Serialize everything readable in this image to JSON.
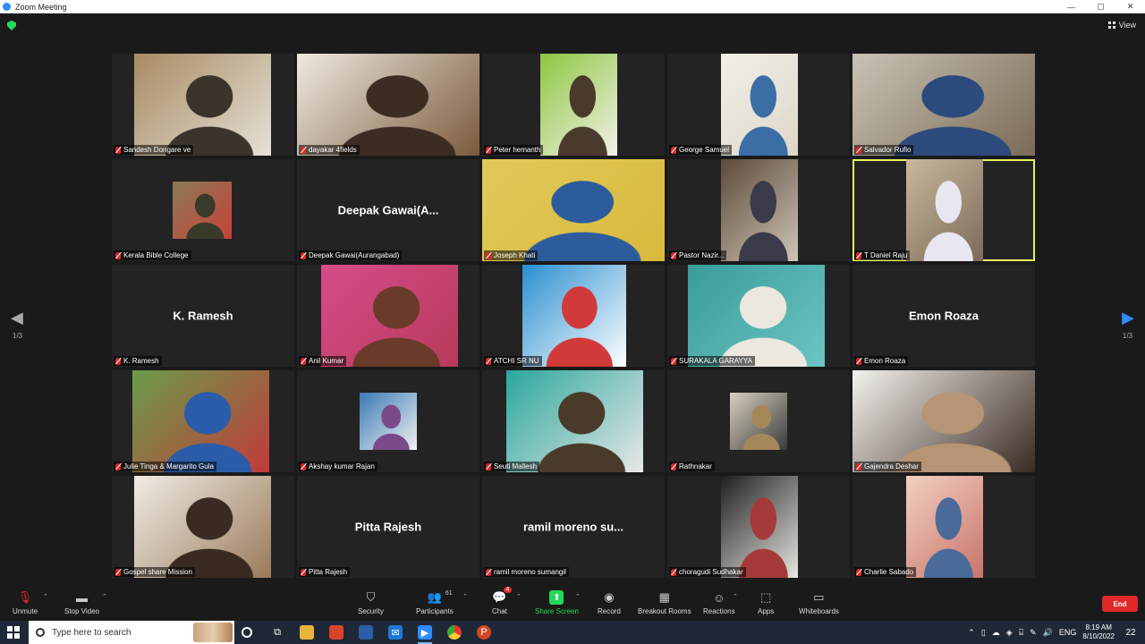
{
  "window": {
    "title": "Zoom Meeting",
    "controls": [
      "—",
      "▢",
      "✕"
    ]
  },
  "view_button": {
    "label": "View",
    "icon": "grid-icon"
  },
  "pagination": {
    "left": "1/3",
    "right": "1/3"
  },
  "participants": [
    {
      "name": "Sandesh Dongare ve",
      "video": true,
      "colors": [
        "#a88a62",
        "#e6e2d8",
        "#3b342b"
      ]
    },
    {
      "name": "dayakar 4fields",
      "video": true,
      "colors": [
        "#efe9e0",
        "#7a5a3c",
        "#3d2c22"
      ]
    },
    {
      "name": "Peter hemanth",
      "video": true,
      "colors": [
        "#8cc63f",
        "#f3f0e8",
        "#4a3a2c"
      ]
    },
    {
      "name": "George Samuel",
      "video": true,
      "colors": [
        "#f2efe8",
        "#ded7c9",
        "#3a6ea5"
      ]
    },
    {
      "name": "Salvador Rufio",
      "video": true,
      "colors": [
        "#c9c3b5",
        "#7a6a55",
        "#2c4a7c"
      ]
    },
    {
      "name": "Kerala Bible College",
      "video": true,
      "colors": [
        "#8a7a55",
        "#c7423a",
        "#3a3a2a"
      ]
    },
    {
      "name": "Deepak Gawai(Aurangabad)",
      "video": false,
      "display": "Deepak  Gawai(A..."
    },
    {
      "name": "Joseph Khati",
      "video": true,
      "colors": [
        "#e2c95a",
        "#d9b93c",
        "#2d5c9c"
      ]
    },
    {
      "name": "Pastor Nazir...",
      "video": true,
      "colors": [
        "#5c4a3a",
        "#cfc5b5",
        "#3a3a4a"
      ]
    },
    {
      "name": "T Daniel Raju",
      "video": true,
      "colors": [
        "#c9b89a",
        "#7a6a5a",
        "#e8e6f0"
      ]
    },
    {
      "name": "K. Ramesh",
      "video": false,
      "display": "K. Ramesh"
    },
    {
      "name": "Anil Kumar",
      "video": true,
      "colors": [
        "#d54c8a",
        "#b83a5a",
        "#6a3a2a"
      ]
    },
    {
      "name": "ATCHI SR NU",
      "video": true,
      "colors": [
        "#2a8fd0",
        "#ffffff",
        "#d23a3a"
      ]
    },
    {
      "name": "SURAKALA GARAYYA",
      "video": true,
      "colors": [
        "#3a9c9a",
        "#6cc5c2",
        "#ece8e0"
      ]
    },
    {
      "name": "Emon Roaza",
      "video": false,
      "display": "Emon Roaza"
    },
    {
      "name": "Julie Tinga & Margarito Gula",
      "video": true,
      "colors": [
        "#6a9c4a",
        "#c23a3a",
        "#2a5caa"
      ]
    },
    {
      "name": "Akshay kumar Rajan",
      "video": true,
      "colors": [
        "#3a7ab5",
        "#f0f0f0",
        "#7a4a8a"
      ]
    },
    {
      "name": "Seuti Mallesh",
      "video": true,
      "colors": [
        "#2aa79c",
        "#e8e8e8",
        "#4a3a2a"
      ]
    },
    {
      "name": "Rathnakar",
      "video": true,
      "colors": [
        "#d8d0c0",
        "#3a3a3a",
        "#a5885a"
      ]
    },
    {
      "name": "Gajendra Deshar",
      "video": true,
      "colors": [
        "#f4f2ee",
        "#3a2a22",
        "#b59575"
      ]
    },
    {
      "name": "Gospel share Mission",
      "video": true,
      "colors": [
        "#f0ece5",
        "#9a7a5a",
        "#3a2a22"
      ]
    },
    {
      "name": "Pitta Rajesh",
      "video": false,
      "display": "Pitta Rajesh"
    },
    {
      "name": "ramil moreno sumangil",
      "video": false,
      "display": "ramil moreno su..."
    },
    {
      "name": "choragudi Sudhakar",
      "video": true,
      "colors": [
        "#1f1f1f",
        "#e8e6e0",
        "#a53a3a"
      ]
    },
    {
      "name": "Charlie Sabado",
      "video": true,
      "colors": [
        "#f2d0c0",
        "#c8746a",
        "#4a6a9a"
      ]
    }
  ],
  "toolbar": {
    "unmute": "Unmute",
    "stop_video": "Stop Video",
    "security": "Security",
    "participants": "Participants",
    "participants_count": "61",
    "chat": "Chat",
    "chat_badge": "4",
    "share_screen": "Share Screen",
    "record": "Record",
    "breakout_rooms": "Breakout Rooms",
    "reactions": "Reactions",
    "apps": "Apps",
    "whiteboards": "Whiteboards",
    "end": "End"
  },
  "taskbar": {
    "search_placeholder": "Type here to search",
    "language": "ENG",
    "time": "8:19 AM",
    "date": "8/10/2022",
    "notification_count": "22"
  }
}
